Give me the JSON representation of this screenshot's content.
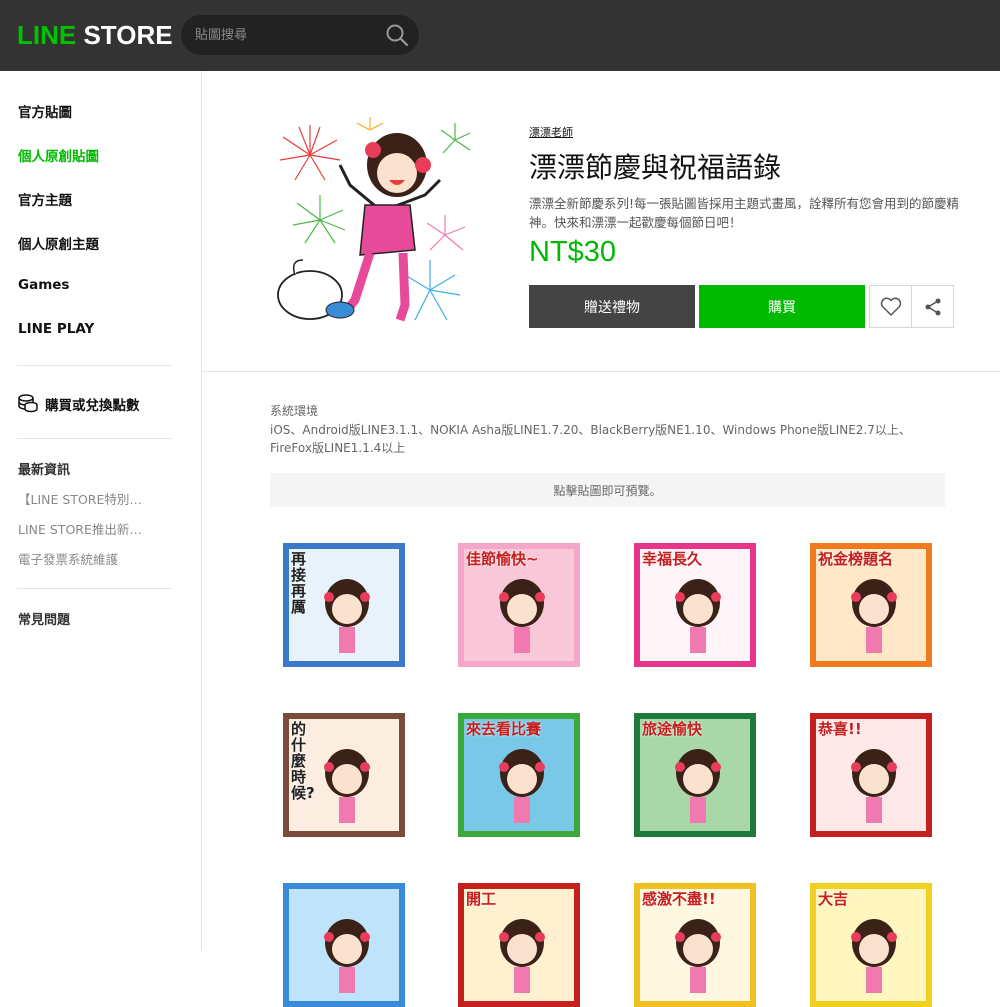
{
  "header": {
    "logo_line": "LINE",
    "logo_store": "STORE",
    "search_placeholder": "貼圖搜尋"
  },
  "sidebar": {
    "nav": [
      {
        "label": "官方貼圖",
        "active": false
      },
      {
        "label": "個人原創貼圖",
        "active": true
      },
      {
        "label": "官方主題",
        "active": false
      },
      {
        "label": "個人原創主題",
        "active": false
      },
      {
        "label": "Games",
        "active": false
      },
      {
        "label": "LINE PLAY",
        "active": false
      }
    ],
    "points_label": "購買或兌換點數",
    "news_heading": "最新資訊",
    "news": [
      "【LINE STORE特別…",
      "LINE STORE推出新…",
      "電子發票系統維護"
    ],
    "faq": "常見問題"
  },
  "product": {
    "author": "漂漂老師",
    "title": "漂漂節慶與祝福語錄",
    "description": "漂漂全新節慶系列!每一張貼圖皆採用主題式畫風，詮釋所有您會用到的節慶精神。快來和漂漂一起歡慶每個節日吧！",
    "price": "NT$30",
    "gift_label": "贈送禮物",
    "buy_label": "購買"
  },
  "environment": {
    "label": "系統環境",
    "text": "iOS、Android版LINE3.1.1、NOKIA Asha版LINE1.7.20、BlackBerry版NE1.10、Windows Phone版LINE2.7以上、FireFox版LINE1.1.4以上"
  },
  "preview_hint": "點擊貼圖即可預覽。",
  "stickers": [
    {
      "text": "再接再厲",
      "frame": "#3a78c9"
    },
    {
      "text": "佳節愉快~",
      "frame": "#f4a7c9"
    },
    {
      "text": "幸福長久",
      "frame": "#e8348a"
    },
    {
      "text": "祝金榜題名",
      "frame": "#f07a1e"
    },
    {
      "text": "的什麼時候?",
      "frame": "#7a4a3a"
    },
    {
      "text": "來去看比賽",
      "frame": "#3aa83a"
    },
    {
      "text": "旅途愉快",
      "frame": "#1e7a3a"
    },
    {
      "text": "恭喜!!",
      "frame": "#c42020"
    },
    {
      "text": "",
      "frame": "#3a8cd8"
    },
    {
      "text": "開工",
      "frame": "#c42020"
    },
    {
      "text": "感激不盡!!",
      "frame": "#f0c020"
    },
    {
      "text": "大吉",
      "frame": "#f0d020"
    }
  ]
}
